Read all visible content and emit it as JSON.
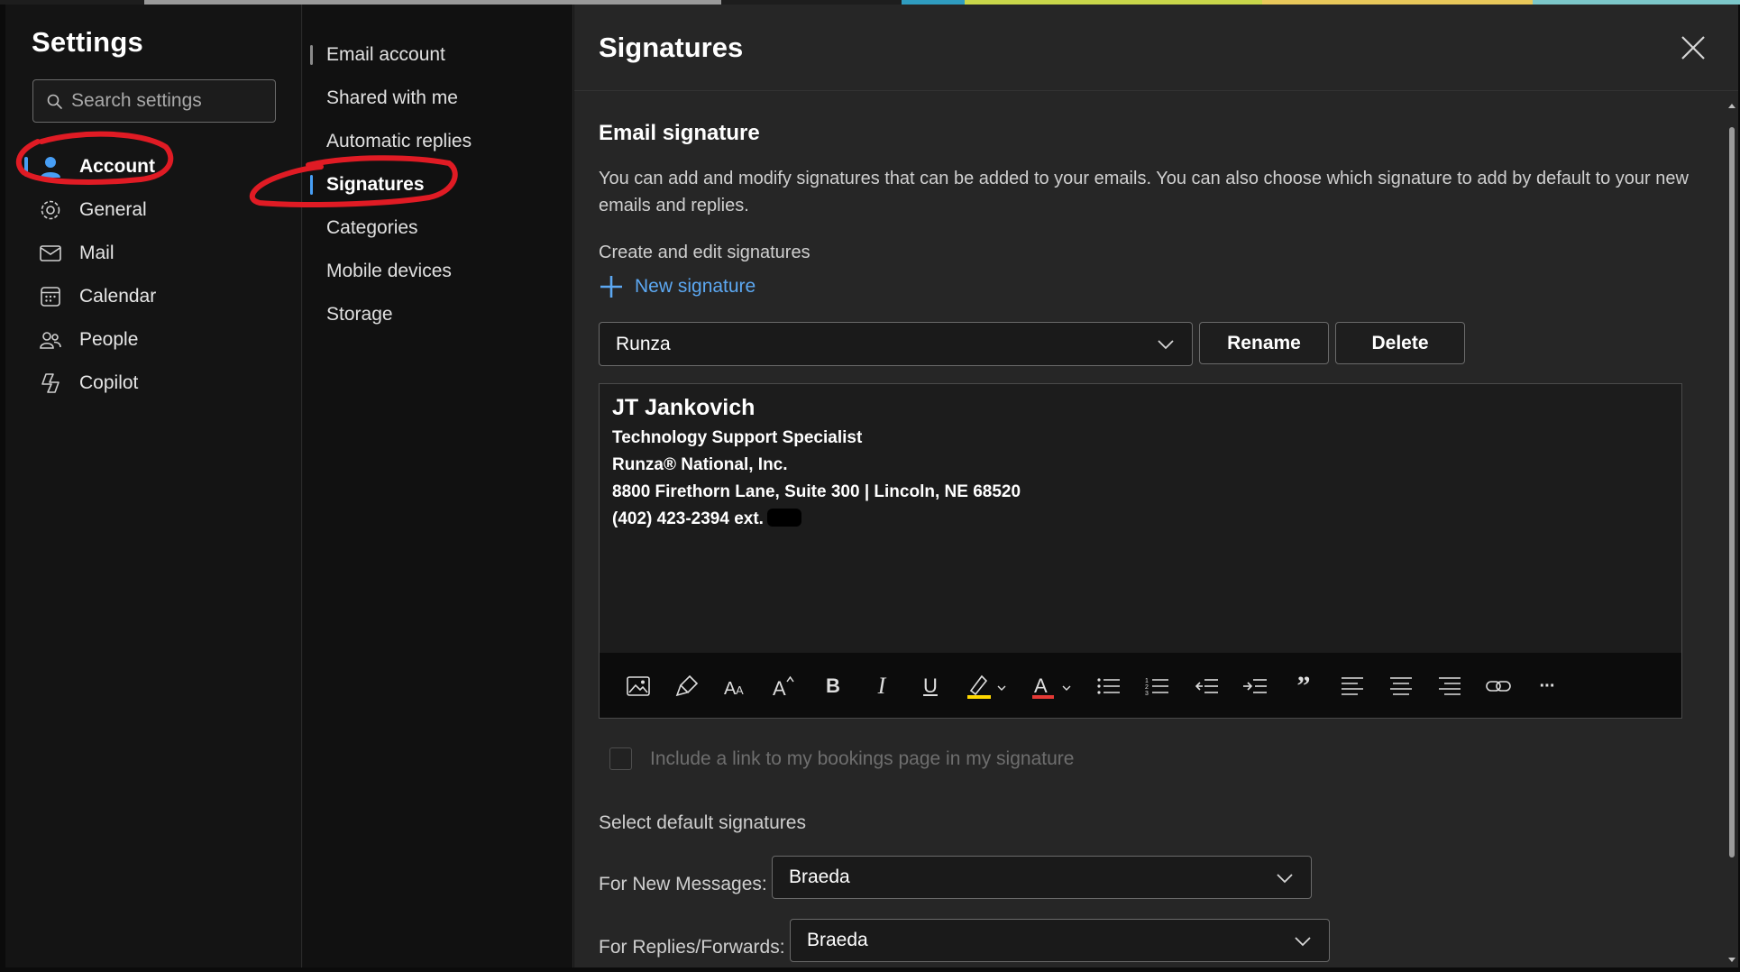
{
  "colors": {
    "accent": "#479ef5",
    "link": "#5ca8f2",
    "annotation": "#e01b24",
    "highlight_yellow": "#ffd800",
    "font_color_red": "#e53935"
  },
  "nav": {
    "title": "Settings",
    "search_placeholder": "Search settings",
    "items": [
      {
        "label": "Account",
        "icon": "person-icon",
        "active": true
      },
      {
        "label": "General",
        "icon": "gear-icon",
        "active": false
      },
      {
        "label": "Mail",
        "icon": "mail-icon",
        "active": false
      },
      {
        "label": "Calendar",
        "icon": "calendar-icon",
        "active": false
      },
      {
        "label": "People",
        "icon": "people-icon",
        "active": false
      },
      {
        "label": "Copilot",
        "icon": "copilot-icon",
        "active": false
      }
    ]
  },
  "subnav": {
    "items": [
      {
        "label": "Email account",
        "active": false
      },
      {
        "label": "Shared with me",
        "active": false
      },
      {
        "label": "Automatic replies",
        "active": false
      },
      {
        "label": "Signatures",
        "active": true
      },
      {
        "label": "Categories",
        "active": false
      },
      {
        "label": "Mobile devices",
        "active": false
      },
      {
        "label": "Storage",
        "active": false
      }
    ]
  },
  "main": {
    "title": "Signatures",
    "section_title": "Email signature",
    "description": "You can add and modify signatures that can be added to your emails. You can also choose which signature to add by default to your new emails and replies.",
    "create_label": "Create and edit signatures",
    "new_signature_label": "New signature",
    "selected_signature": "Runza",
    "rename_label": "Rename",
    "delete_label": "Delete",
    "signature": {
      "name": "JT Jankovich",
      "lines": [
        "Technology Support Specialist",
        "Runza® National, Inc.",
        "8800 Firethorn Lane, Suite 300 | Lincoln, NE 68520",
        "(402) 423-2394 ext."
      ]
    },
    "toolbar": {
      "icons": [
        "insert-picture-icon",
        "format-painter-icon",
        "font-size-icon",
        "increase-font-icon",
        "bold-icon",
        "italic-icon",
        "underline-icon",
        "highlight-icon",
        "font-color-icon",
        "bullets-icon",
        "numbering-icon",
        "decrease-indent-icon",
        "increase-indent-icon",
        "quote-icon",
        "align-left-icon",
        "align-center-icon",
        "align-right-icon",
        "link-icon",
        "more-options-icon"
      ],
      "bold_glyph": "B",
      "italic_glyph": "I",
      "underline_glyph": "U",
      "quote_glyph": "”",
      "more_glyph": "···"
    },
    "bookings_checkbox_label": "Include a link to my bookings page in my signature",
    "default_section_label": "Select default signatures",
    "new_messages_label": "For New Messages:",
    "new_messages_value": "Braeda",
    "replies_label": "For Replies/Forwards:",
    "replies_value": "Braeda"
  }
}
